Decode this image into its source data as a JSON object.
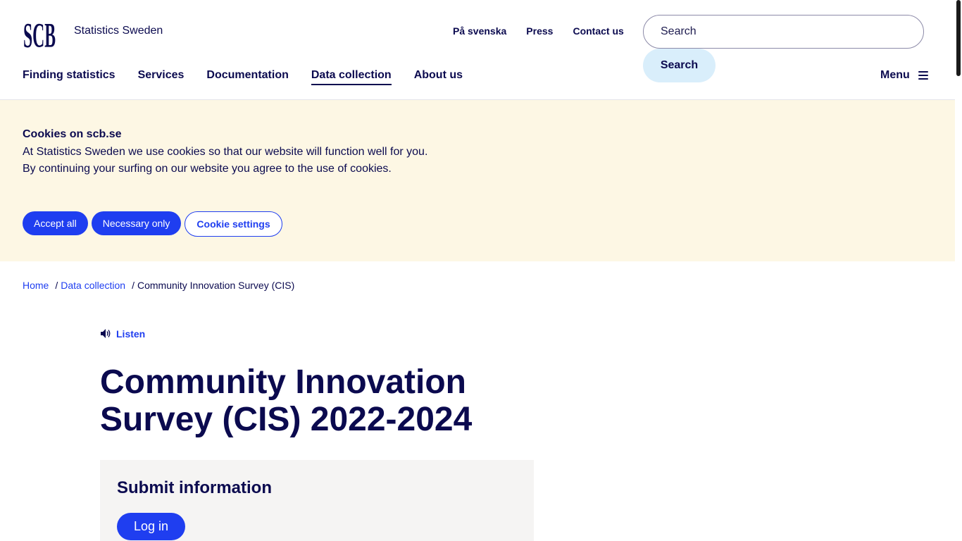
{
  "header": {
    "site_name": "Statistics Sweden",
    "top_links": [
      "På svenska",
      "Press",
      "Contact us"
    ],
    "search": {
      "placeholder": "Search",
      "button_label": "Search"
    },
    "main_nav": [
      {
        "label": "Finding statistics",
        "active": false
      },
      {
        "label": "Services",
        "active": false
      },
      {
        "label": "Documentation",
        "active": false
      },
      {
        "label": "Data collection",
        "active": true
      },
      {
        "label": "About us",
        "active": false
      }
    ],
    "menu_label": "Menu"
  },
  "cookie_banner": {
    "title": "Cookies on scb.se",
    "text": "At Statistics Sweden we use cookies so that our website will function well for you. By continuing your surfing on our website you agree to the use of cookies.",
    "accept_all": "Accept all",
    "necessary_only": "Necessary only",
    "settings": "Cookie settings"
  },
  "breadcrumb": {
    "home": "Home",
    "section": "Data collection",
    "current": "Community Innovation Survey (CIS)",
    "separator": "/"
  },
  "listen_label": "Listen",
  "page_title": "Community Innovation Survey (CIS) 2022-2024",
  "submit": {
    "title": "Submit information",
    "login_label": "Log in"
  },
  "colors": {
    "brand_navy": "#0b0a4f",
    "link_blue": "#1f3ef0",
    "cookie_bg": "#fdf7e4",
    "search_button_bg": "#d9eefb",
    "submit_bg": "#f5f4f3"
  },
  "icons": {
    "logo": "scb-logo",
    "listen": "speaker-icon",
    "menu": "hamburger-icon"
  }
}
